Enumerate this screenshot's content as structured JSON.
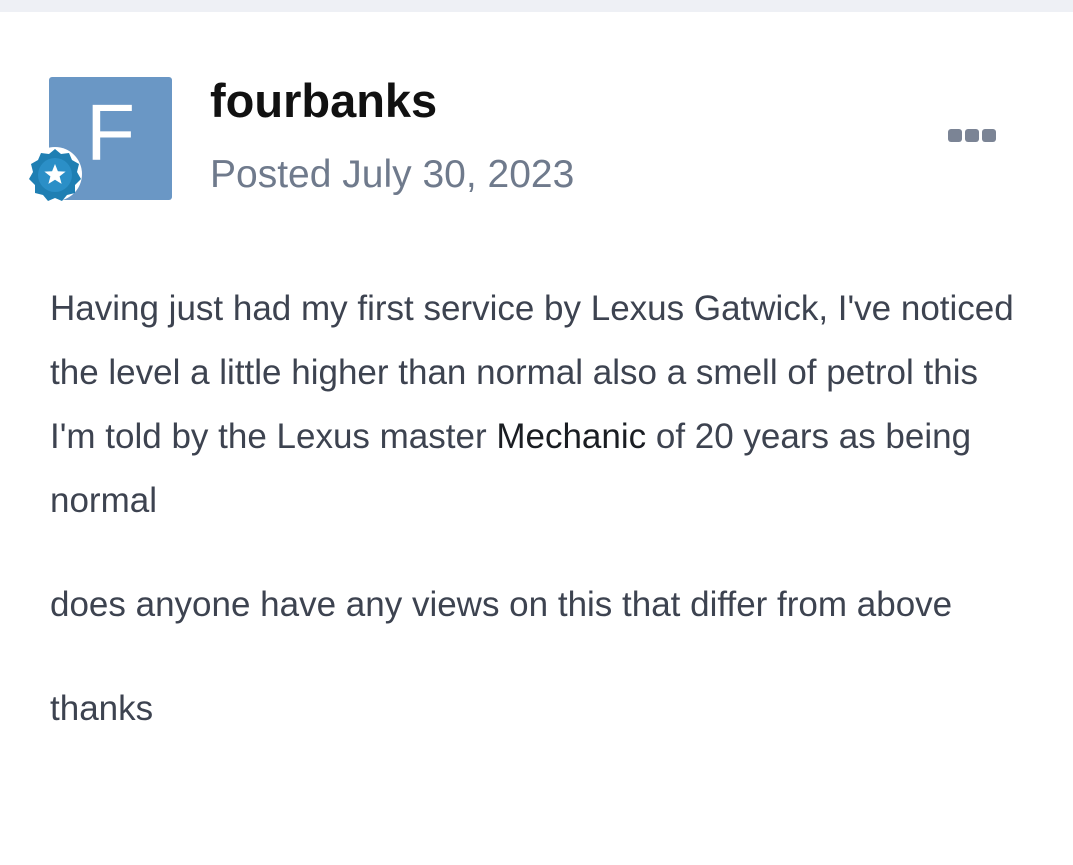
{
  "post": {
    "avatar_letter": "F",
    "badge_icon": "star-badge-icon",
    "author": "fourbanks",
    "posted_prefix": "Posted",
    "posted_date": "July 30, 2023",
    "more_icon": "ellipsis-icon",
    "paragraphs": {
      "p1_before": "Having just had my first service by Lexus Gatwick, I've noticed the level a little higher than normal also a smell of petrol this I'm told by the Lexus master ",
      "p1_term": "Mechanic",
      "p1_after": " of 20 years as being normal",
      "p2": "does anyone have any views on this that differ from above",
      "p3": "thanks"
    }
  },
  "colors": {
    "avatar_bg": "#6a97c5",
    "badge": "#1f7fb3",
    "meta_text": "#6f7a8c",
    "body_text": "#3d4350",
    "top_strip": "#eef0f5"
  }
}
